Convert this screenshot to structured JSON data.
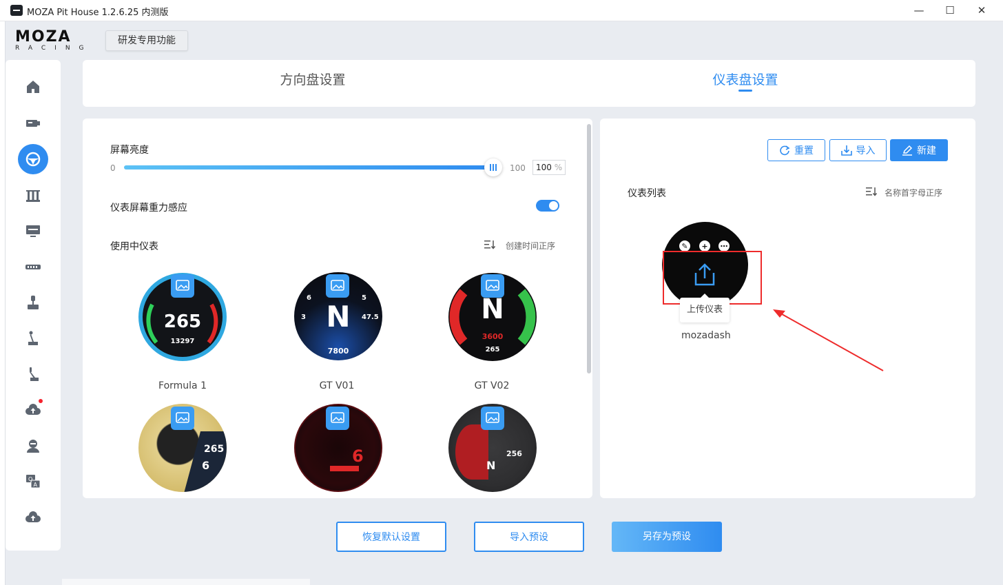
{
  "window": {
    "title": "MOZA Pit House 1.2.6.25 内测版",
    "minimize_icon": "minimize-icon",
    "maximize_icon": "maximize-icon",
    "close_icon": "close-icon"
  },
  "header": {
    "logo_main": "MOZA",
    "logo_sub": "RACING",
    "dev_button": "研发专用功能"
  },
  "sidebar": {
    "items": [
      {
        "name": "home-icon",
        "active": false
      },
      {
        "name": "wheelbase-icon",
        "active": false
      },
      {
        "name": "steering-wheel-icon",
        "active": true
      },
      {
        "name": "pedals-icon",
        "active": false
      },
      {
        "name": "dashboard-display-icon",
        "active": false
      },
      {
        "name": "hub-icon",
        "active": false
      },
      {
        "name": "joystick-icon",
        "active": false
      },
      {
        "name": "shifter-icon",
        "active": false
      },
      {
        "name": "handbrake-icon",
        "active": false
      },
      {
        "name": "cloud-upload-icon",
        "active": false,
        "badge": true
      },
      {
        "name": "user-icon",
        "active": false
      },
      {
        "name": "qa-icon",
        "active": false
      },
      {
        "name": "cloud-update-icon",
        "active": false
      }
    ]
  },
  "tabs": {
    "wheel_settings": "方向盘设置",
    "dashboard_settings": "仪表盘设置",
    "active": "dashboard_settings"
  },
  "left_panel": {
    "brightness_label": "屏幕亮度",
    "brightness_min": "0",
    "brightness_max": "100",
    "brightness_value": "100",
    "brightness_unit": "%",
    "brightness_fraction": 1.0,
    "gravity_label": "仪表屏幕重力感应",
    "gravity_enabled": true,
    "in_use_label": "使用中仪表",
    "sort_label": "创建时间正序",
    "dials": [
      {
        "name": "Formula 1",
        "speed": "265",
        "sub": "13297"
      },
      {
        "name": "GT V01",
        "gear": "N",
        "rpm": "7800",
        "left": "3",
        "right": "47.5",
        "top_left": "6",
        "top_right": "5"
      },
      {
        "name": "GT V02",
        "gear": "N",
        "rpm": "3600",
        "speed": "265"
      },
      {
        "name": "",
        "speed": "265",
        "gear": "6"
      },
      {
        "name": "",
        "gear": "6"
      },
      {
        "name": "",
        "gear": "N",
        "speed": "256"
      }
    ]
  },
  "right_panel": {
    "reset_label": "重置",
    "import_label": "导入",
    "new_label": "新建",
    "list_label": "仪表列表",
    "sort_label": "名称首字母正序",
    "dash_name": "mozadash",
    "tooltip": "上传仪表"
  },
  "footer": {
    "restore_default": "恢复默认设置",
    "import_preset": "导入预设",
    "save_as_preset": "另存为预设"
  },
  "colors": {
    "accent": "#2f8cf0",
    "highlight": "#ee2b2b"
  }
}
